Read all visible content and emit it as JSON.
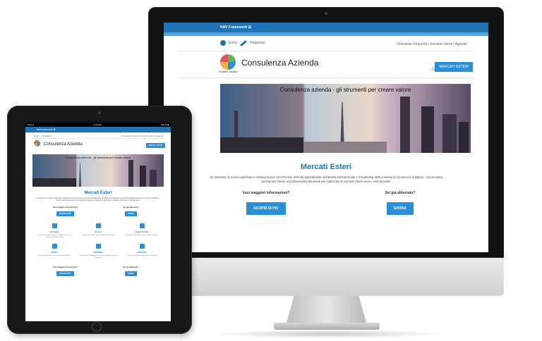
{
  "site": {
    "topbar": "NAV Framework ☰",
    "user_links": [
      "Entra",
      "Registrati"
    ],
    "right_links": "Domande frequenti | Servizio clienti | Agende",
    "logo_text": "Wolters Kluwer",
    "title": "Consulenza Azienda",
    "nav_label": "MERCATI ESTERI",
    "banner_text": "Consulenza azienda - gli strumenti per creare valore",
    "section_title": "Mercati Esteri",
    "description": "Un ambiente di servizi realizzato in collaborazione con Promos, azienda specializzata nell'attività internazionale e il marketing della Camera di Commercio di Milano. I servizi sono pensati per fornire al professionista strumenti per indirizzare le aziende clienti verso i mercati esteri",
    "cta_left": {
      "question": "Vuoi maggiori informazioni?",
      "button": "SCOPRI DI PIÙ"
    },
    "cta_right": {
      "question": "Sei già abbonato?",
      "button": "ENTRA"
    }
  },
  "tablet": {
    "status_left": "iPad ≋",
    "status_time": "9:41 PM",
    "status_right": "100 % ▮",
    "features": [
      {
        "name": "Completo",
        "desc": "Un servizio completo di tutte le informazioni utili per la conoscenza dei mercati esteri"
      },
      {
        "name": "Sicuro",
        "desc": "Un'unica fonte di informazioni affidabili e aggiornate"
      },
      {
        "name": "Approfondito",
        "desc": "Strumenti di approfondimento e supporto operativo"
      },
      {
        "name": "Pratico",
        "desc": "Tutti i servizi sono pensati per un utilizzo immediato"
      },
      {
        "name": "Affidabile",
        "desc": "Contenuti elaborati dagli esperti di Promos e della Camera di Commercio"
      },
      {
        "name": "Garantito",
        "desc": "Assistenza dedicata e aggiornamenti costanti"
      }
    ]
  }
}
